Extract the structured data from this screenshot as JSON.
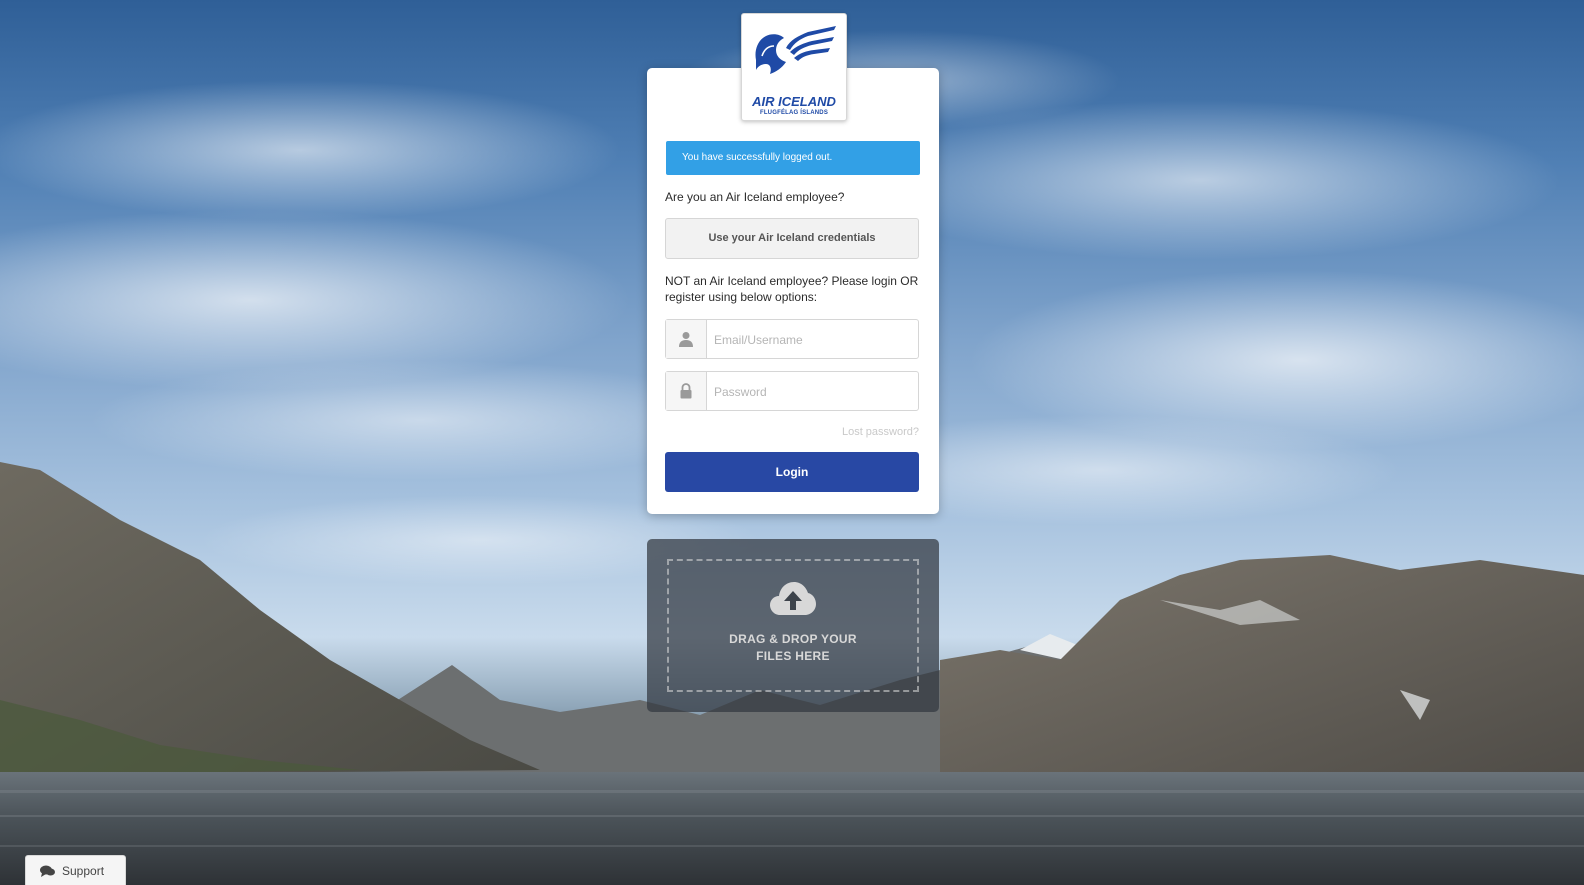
{
  "brand": {
    "title": "AIR ICELAND",
    "subtitle": "FLUGFÉLAG ÍSLANDS",
    "accent_color": "#2848a4",
    "logo_icon": "pegasus-logo"
  },
  "alert": {
    "message": "You have successfully logged out.",
    "color": "#32a0e6"
  },
  "employee": {
    "question": "Are you an Air Iceland employee?",
    "credentials_button": "Use your Air Iceland credentials"
  },
  "guest": {
    "prompt": "NOT an Air Iceland employee? Please login OR register using below options:"
  },
  "form": {
    "email_placeholder": "Email/Username",
    "password_placeholder": "Password",
    "email_icon": "user-icon",
    "password_icon": "lock-icon",
    "lost_password": "Lost password?",
    "login_button": "Login"
  },
  "dropzone": {
    "icon": "cloud-upload-icon",
    "text_line1": "DRAG & DROP YOUR",
    "text_line2": "FILES HERE"
  },
  "support": {
    "icon": "chat-icon",
    "label": "Support"
  }
}
